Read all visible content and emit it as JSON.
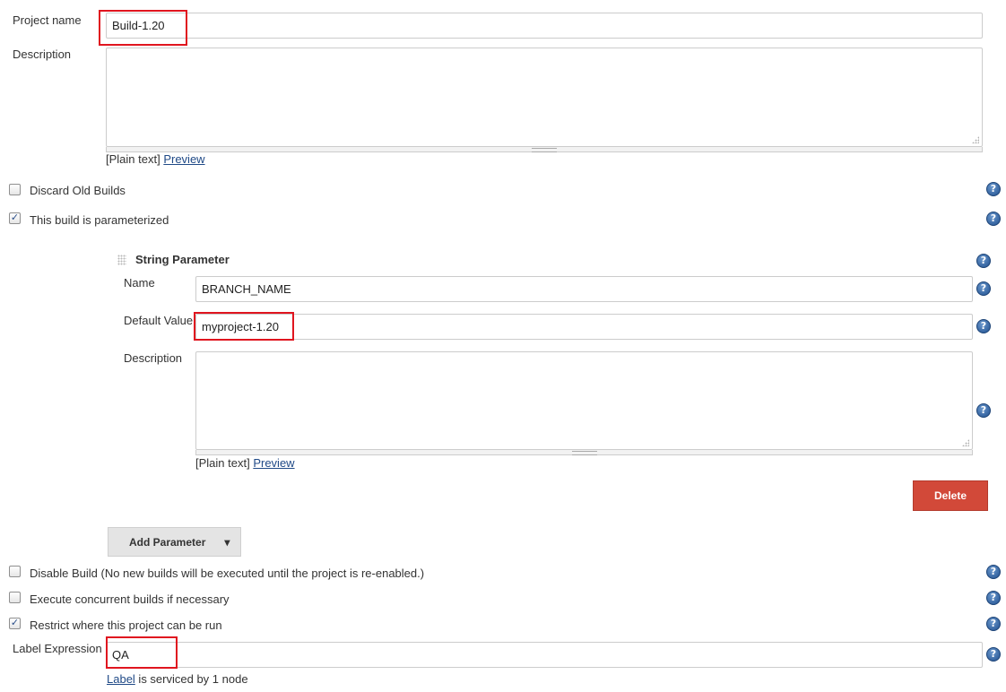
{
  "project": {
    "name_label": "Project name",
    "name_value": "Build-1.20",
    "description_label": "Description",
    "description_value": "",
    "plain_text": "[Plain text]",
    "preview_link": "Preview"
  },
  "options": {
    "discard_old_builds": {
      "label": "Discard Old Builds",
      "checked": false
    },
    "parameterized": {
      "label": "This build is parameterized",
      "checked": true
    },
    "disable_build": {
      "label": "Disable Build (No new builds will be executed until the project is re-enabled.)",
      "checked": false
    },
    "concurrent": {
      "label": "Execute concurrent builds if necessary",
      "checked": false
    },
    "restrict": {
      "label": "Restrict where this project can be run",
      "checked": true
    }
  },
  "string_parameter": {
    "title": "String Parameter",
    "name_label": "Name",
    "name_value": "BRANCH_NAME",
    "default_label": "Default Value",
    "default_value": "myproject-1.20",
    "description_label": "Description",
    "description_value": "",
    "plain_text": "[Plain text]",
    "preview_link": "Preview",
    "delete_button": "Delete"
  },
  "add_parameter": {
    "label": "Add Parameter",
    "caret": "▾"
  },
  "label_expression": {
    "label": "Label Expression",
    "value": "QA",
    "label_link": "Label",
    "serviced_text": " is serviced by 1 node"
  },
  "icons": {
    "help": "?",
    "check": "✓"
  },
  "colors": {
    "highlight": "#e0151f",
    "delete": "#d24939",
    "link": "#204a87",
    "help_icon": "#2b5b99"
  }
}
